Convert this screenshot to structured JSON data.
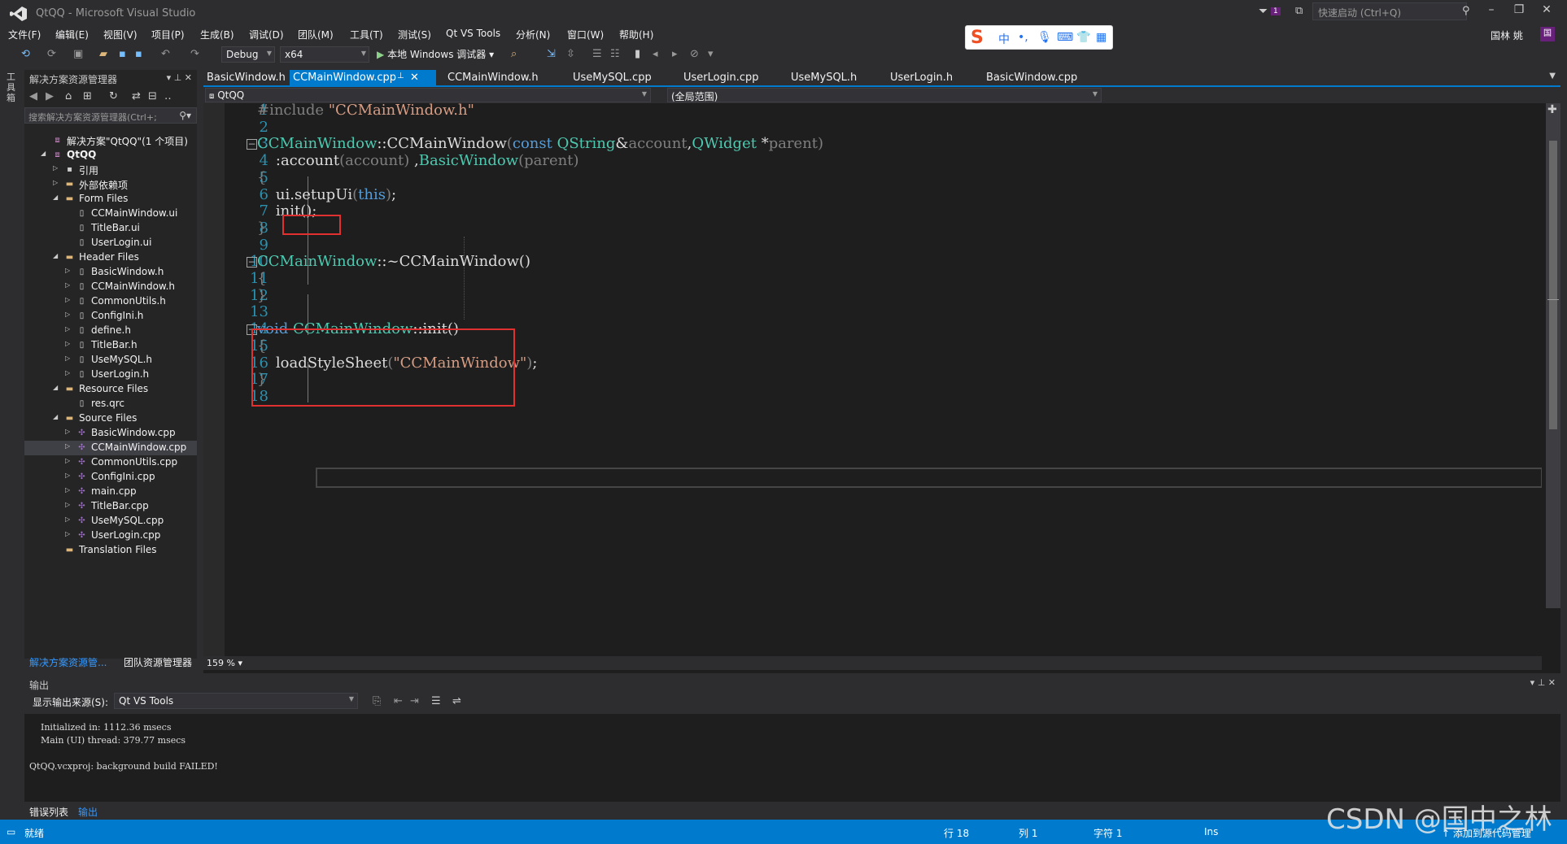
{
  "window": {
    "title": "QtQQ - Microsoft Visual Studio",
    "quick_launch_placeholder": "快速启动 (Ctrl+Q)",
    "notification_count": "1",
    "user": "国林 姚",
    "user_initial": "国"
  },
  "menu": [
    "文件(F)",
    "编辑(E)",
    "视图(V)",
    "项目(P)",
    "生成(B)",
    "调试(D)",
    "团队(M)",
    "工具(T)",
    "测试(S)",
    "Qt VS Tools",
    "分析(N)",
    "窗口(W)",
    "帮助(H)"
  ],
  "ime": {
    "logo": "S",
    "mode": "中"
  },
  "toolbar": {
    "config": "Debug",
    "platform": "x64",
    "run_label": "本地 Windows 调试器"
  },
  "left_strip": {
    "label": "工具箱"
  },
  "solution_explorer": {
    "title": "解决方案资源管理器",
    "search_placeholder": "搜索解决方案资源管理器(Ctrl+;",
    "tree": [
      {
        "label": "解决方案\"QtQQ\"(1 个项目)",
        "level": 0,
        "twisty": "",
        "icon": "solution-icon"
      },
      {
        "label": "QtQQ",
        "level": 0,
        "twisty": "down",
        "icon": "project-icon",
        "bold": true
      },
      {
        "label": "引用",
        "level": 1,
        "twisty": "right",
        "icon": "references-icon"
      },
      {
        "label": "外部依赖项",
        "level": 1,
        "twisty": "right",
        "icon": "folder-icon"
      },
      {
        "label": "Form Files",
        "level": 1,
        "twisty": "down",
        "icon": "folder-icon"
      },
      {
        "label": "CCMainWindow.ui",
        "level": 2,
        "twisty": "",
        "icon": "file-icon"
      },
      {
        "label": "TitleBar.ui",
        "level": 2,
        "twisty": "",
        "icon": "file-icon"
      },
      {
        "label": "UserLogin.ui",
        "level": 2,
        "twisty": "",
        "icon": "file-icon"
      },
      {
        "label": "Header Files",
        "level": 1,
        "twisty": "down",
        "icon": "folder-icon"
      },
      {
        "label": "BasicWindow.h",
        "level": 2,
        "twisty": "right",
        "icon": "header-file-icon"
      },
      {
        "label": "CCMainWindow.h",
        "level": 2,
        "twisty": "right",
        "icon": "header-file-icon"
      },
      {
        "label": "CommonUtils.h",
        "level": 2,
        "twisty": "right",
        "icon": "header-file-icon"
      },
      {
        "label": "ConfigIni.h",
        "level": 2,
        "twisty": "right",
        "icon": "header-file-icon"
      },
      {
        "label": "define.h",
        "level": 2,
        "twisty": "right",
        "icon": "header-file-icon"
      },
      {
        "label": "TitleBar.h",
        "level": 2,
        "twisty": "right",
        "icon": "header-file-icon"
      },
      {
        "label": "UseMySQL.h",
        "level": 2,
        "twisty": "right",
        "icon": "header-file-icon"
      },
      {
        "label": "UserLogin.h",
        "level": 2,
        "twisty": "right",
        "icon": "header-file-icon"
      },
      {
        "label": "Resource Files",
        "level": 1,
        "twisty": "down",
        "icon": "folder-icon"
      },
      {
        "label": "res.qrc",
        "level": 2,
        "twisty": "",
        "icon": "file-icon"
      },
      {
        "label": "Source Files",
        "level": 1,
        "twisty": "down",
        "icon": "folder-icon"
      },
      {
        "label": "BasicWindow.cpp",
        "level": 2,
        "twisty": "right",
        "icon": "cpp-file-icon"
      },
      {
        "label": "CCMainWindow.cpp",
        "level": 2,
        "twisty": "right",
        "icon": "cpp-file-icon",
        "selected": true
      },
      {
        "label": "CommonUtils.cpp",
        "level": 2,
        "twisty": "right",
        "icon": "cpp-file-icon"
      },
      {
        "label": "ConfigIni.cpp",
        "level": 2,
        "twisty": "right",
        "icon": "cpp-file-icon"
      },
      {
        "label": "main.cpp",
        "level": 2,
        "twisty": "right",
        "icon": "cpp-file-icon"
      },
      {
        "label": "TitleBar.cpp",
        "level": 2,
        "twisty": "right",
        "icon": "cpp-file-icon"
      },
      {
        "label": "UseMySQL.cpp",
        "level": 2,
        "twisty": "right",
        "icon": "cpp-file-icon"
      },
      {
        "label": "UserLogin.cpp",
        "level": 2,
        "twisty": "right",
        "icon": "cpp-file-icon"
      },
      {
        "label": "Translation Files",
        "level": 1,
        "twisty": "",
        "icon": "folder-icon"
      }
    ],
    "bottom_tabs": [
      "解决方案资源管...",
      "团队资源管理器"
    ]
  },
  "editor": {
    "tabs": [
      {
        "label": "BasicWindow.h",
        "active": false
      },
      {
        "label": "CCMainWindow.cpp",
        "active": true
      },
      {
        "label": "CCMainWindow.h",
        "active": false
      },
      {
        "label": "UseMySQL.cpp",
        "active": false
      },
      {
        "label": "UserLogin.cpp",
        "active": false
      },
      {
        "label": "UseMySQL.h",
        "active": false
      },
      {
        "label": "UserLogin.h",
        "active": false
      },
      {
        "label": "BasicWindow.cpp",
        "active": false
      }
    ],
    "project_combo": "QtQQ",
    "scope_combo": "(全局范围)",
    "zoom": "159 %",
    "lines": [
      {
        "n": "1",
        "tokens": [
          [
            "pr",
            "#include "
          ],
          [
            "st",
            "\"CCMainWindow.h\""
          ]
        ]
      },
      {
        "n": "2",
        "tokens": []
      },
      {
        "n": "3",
        "fold": true,
        "tokens": [
          [
            "ty",
            "CCMainWindow"
          ],
          [
            "fn",
            "::"
          ],
          [
            "fn",
            "CCMainWindow"
          ],
          [
            "pr",
            "("
          ],
          [
            "kw",
            "const "
          ],
          [
            "ty",
            "QString"
          ],
          [
            "fn",
            "&"
          ],
          [
            "pr",
            "account"
          ],
          [
            "fn",
            ","
          ],
          [
            "ty",
            "QWidget "
          ],
          [
            "fn",
            "*"
          ],
          [
            "pr",
            "parent)"
          ]
        ]
      },
      {
        "n": "4",
        "tokens": [
          [
            "fn",
            "    :account"
          ],
          [
            "pr",
            "(account)"
          ],
          [
            "fn",
            " ,"
          ],
          [
            "ty",
            "BasicWindow"
          ],
          [
            "pr",
            "(parent)"
          ]
        ]
      },
      {
        "n": "5",
        "tokens": [
          [
            "pr",
            "{"
          ]
        ]
      },
      {
        "n": "6",
        "tokens": [
          [
            "fn",
            "    ui.setupUi"
          ],
          [
            "pr",
            "("
          ],
          [
            "kw",
            "this"
          ],
          [
            "pr",
            ")"
          ],
          [
            "fn",
            ";"
          ]
        ]
      },
      {
        "n": "7",
        "tokens": [
          [
            "fn",
            "    init();"
          ]
        ]
      },
      {
        "n": "8",
        "tokens": [
          [
            "pr",
            "}"
          ]
        ]
      },
      {
        "n": "9",
        "tokens": []
      },
      {
        "n": "10",
        "fold": true,
        "tokens": [
          [
            "ty",
            "CCMainWindow"
          ],
          [
            "fn",
            "::~CCMainWindow()"
          ]
        ]
      },
      {
        "n": "11",
        "tokens": [
          [
            "pr",
            "{"
          ]
        ]
      },
      {
        "n": "12",
        "tokens": [
          [
            "pr",
            "}"
          ]
        ]
      },
      {
        "n": "13",
        "tokens": []
      },
      {
        "n": "14",
        "fold": true,
        "tokens": [
          [
            "kw",
            "void "
          ],
          [
            "ty",
            "CCMainWindow"
          ],
          [
            "fn",
            "::init()"
          ]
        ]
      },
      {
        "n": "15",
        "tokens": [
          [
            "pr",
            "{"
          ]
        ]
      },
      {
        "n": "16",
        "tokens": [
          [
            "fn",
            "    loadStyleSheet"
          ],
          [
            "pr",
            "("
          ],
          [
            "st",
            "\"CCMainWindow\""
          ],
          [
            "pr",
            ")"
          ],
          [
            "fn",
            ";"
          ]
        ]
      },
      {
        "n": "17",
        "tokens": [
          [
            "pr",
            "}"
          ]
        ]
      },
      {
        "n": "18",
        "tokens": []
      }
    ]
  },
  "output": {
    "title": "输出",
    "source_label": "显示输出来源(S):",
    "source_value": "Qt VS Tools",
    "lines": [
      "    Initialized in: 1112.36 msecs",
      "    Main (UI) thread: 379.77 msecs",
      "",
      "QtQQ.vcxproj: background build FAILED!"
    ],
    "bottom_tabs": [
      "错误列表",
      "输出"
    ]
  },
  "status": {
    "left": "就绪",
    "row": "行 18",
    "col": "列 1",
    "char": "字符 1",
    "mode": "Ins",
    "source_control": "↑ 添加到源代码管理"
  },
  "watermark": "CSDN @国中之林",
  "colors": {
    "accent": "#007acc",
    "highlight_box": "#e03030",
    "keyword": "#569cd6",
    "type": "#4ec9b0",
    "string": "#d69d85"
  }
}
